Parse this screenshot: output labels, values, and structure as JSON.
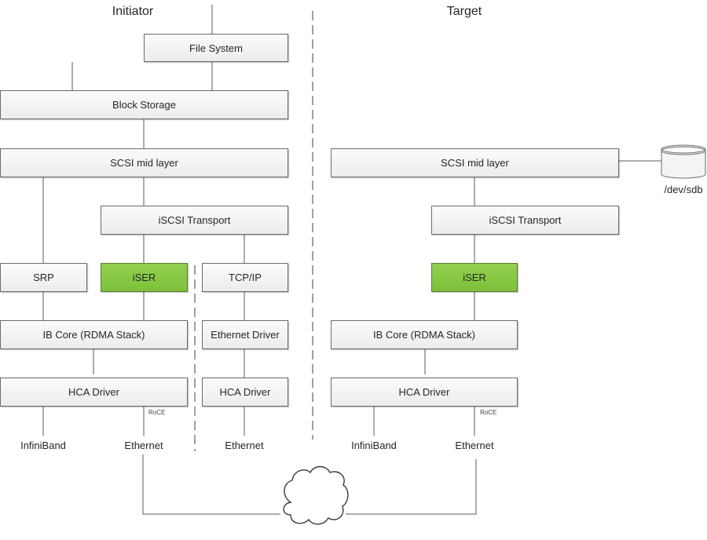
{
  "headers": {
    "initiator": "Initiator",
    "target": "Target"
  },
  "initiator": {
    "file_system": "File System",
    "block_storage": "Block Storage",
    "scsi_mid_layer": "SCSI mid layer",
    "iscsi_transport": "iSCSI Transport",
    "srp": "SRP",
    "iser": "iSER",
    "tcp_ip": "TCP/IP",
    "ib_core": "IB Core (RDMA Stack)",
    "ethernet_driver": "Ethernet Driver",
    "hca_driver": "HCA Driver",
    "hca_driver_eth": "HCA Driver",
    "roce": "RoCE",
    "infiniband": "InfiniBand",
    "ethernet": "Ethernet",
    "ethernet_tcp": "Ethernet"
  },
  "target": {
    "scsi_mid_layer": "SCSI mid layer",
    "iscsi_transport": "iSCSI Transport",
    "iser": "iSER",
    "ib_core": "IB Core (RDMA Stack)",
    "hca_driver": "HCA Driver",
    "roce": "RoCE",
    "infiniband": "InfiniBand",
    "ethernet": "Ethernet",
    "disk_label": "/dev/sdb"
  },
  "colors": {
    "highlight": "#92d050",
    "box_border": "#6b6b6b",
    "line": "#595959"
  }
}
